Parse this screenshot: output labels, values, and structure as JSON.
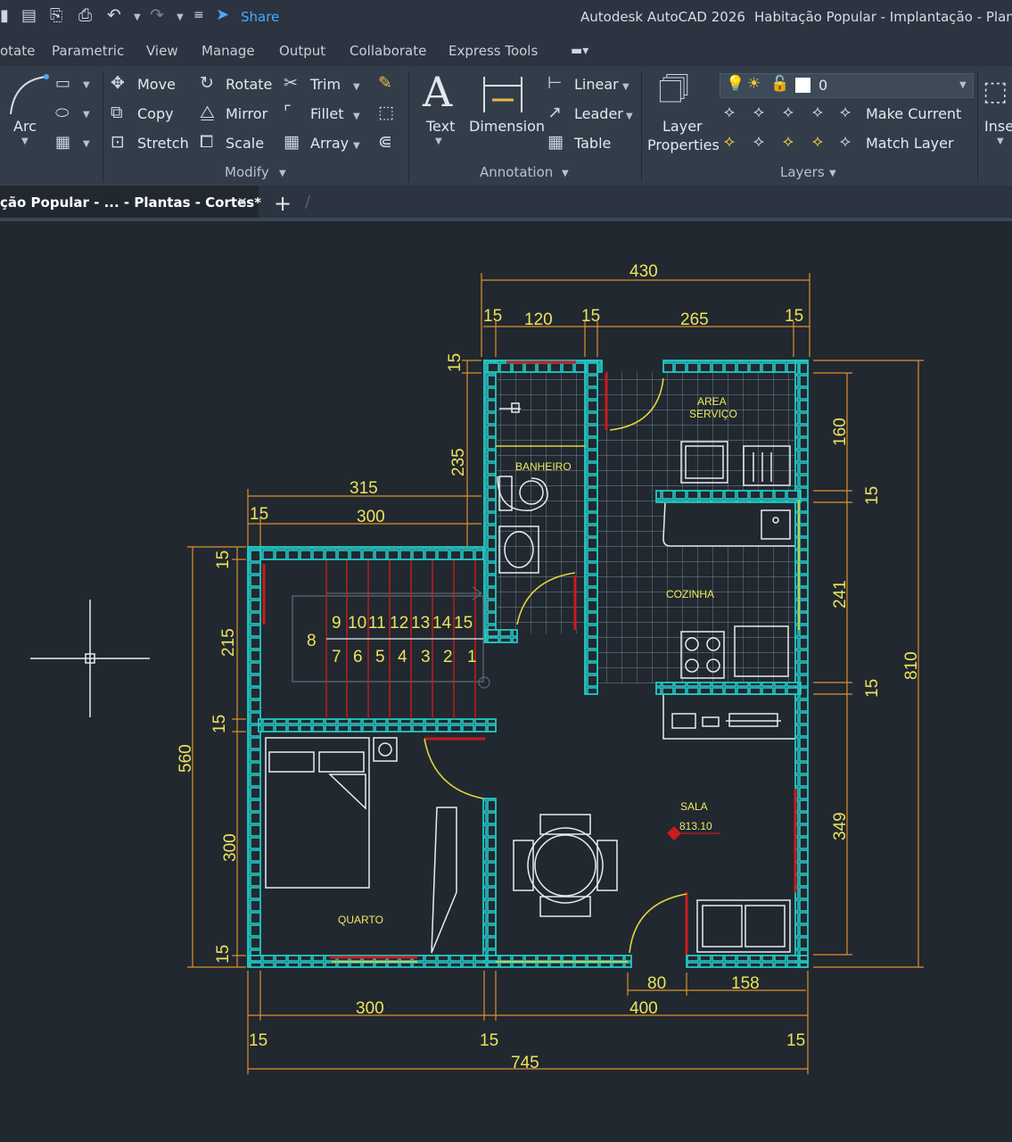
{
  "window": {
    "share_label": "Share",
    "app_title": "Autodesk AutoCAD 2026",
    "doc_title": "Habitação Popular - Implantação - Plan"
  },
  "menu": [
    "otate",
    "Parametric",
    "View",
    "Manage",
    "Output",
    "Collaborate",
    "Express Tools"
  ],
  "ribbon": {
    "draw": {
      "arc": "Arc"
    },
    "modify": {
      "move": "Move",
      "rotate": "Rotate",
      "trim": "Trim",
      "copy": "Copy",
      "mirror": "Mirror",
      "fillet": "Fillet",
      "stretch": "Stretch",
      "scale": "Scale",
      "array": "Array",
      "panel": "Modify"
    },
    "annotation": {
      "text": "Text",
      "dimension": "Dimension",
      "linear": "Linear",
      "leader": "Leader",
      "table": "Table",
      "panel": "Annotation"
    },
    "layers": {
      "layer_properties_1": "Layer",
      "layer_properties_2": "Properties",
      "current_layer": "0",
      "make_current": "Make Current",
      "match_layer": "Match Layer",
      "panel": "Layers"
    },
    "insert": {
      "label": "Inse"
    }
  },
  "tabs": {
    "active": "ção Popular - ... - Plantas - Cortes*",
    "close": "✕",
    "new": "+"
  },
  "drawing": {
    "dims": {
      "top_overall": "430",
      "top_15a": "15",
      "top_120": "120",
      "top_15b": "15",
      "top_265": "265",
      "top_15c": "15",
      "left_315": "315",
      "left_15": "15",
      "left_300": "300",
      "v_15_top": "15",
      "v_235": "235",
      "lv_15a": "15",
      "lv_215": "215",
      "lv_15b": "15",
      "lv_300": "300",
      "lv_15c": "15",
      "lv_560": "560",
      "rv_160": "160",
      "rv_15a": "15",
      "rv_241": "241",
      "rv_15b": "15",
      "rv_349": "349",
      "rv_810": "810",
      "b_80": "80",
      "b_158": "158",
      "b_300": "300",
      "b_400": "400",
      "b_15a": "15",
      "b_15b": "15",
      "b_15c": "15",
      "b_745": "745"
    },
    "rooms": {
      "area_servico_1": "AREA",
      "area_servico_2": "SERVIÇO",
      "banheiro": "BANHEIRO",
      "cozinha": "COZINHA",
      "sala": "SALA",
      "level": "813.10",
      "quarto": "QUARTO"
    },
    "stairs": {
      "top": [
        "9",
        "10",
        "11",
        "12",
        "13",
        "14",
        "15"
      ],
      "landing": "8",
      "bottom": [
        "7",
        "6",
        "5",
        "4",
        "3",
        "2",
        "1"
      ]
    }
  },
  "colors": {
    "wall": "#23c7c4",
    "dim": "#e0902a",
    "dim_text": "#ece35a",
    "room_text": "#f0e85a",
    "furniture": "#e8ecef",
    "door": "#e2d43a",
    "window": "#c91c1c",
    "grid": "#7d8a96"
  }
}
